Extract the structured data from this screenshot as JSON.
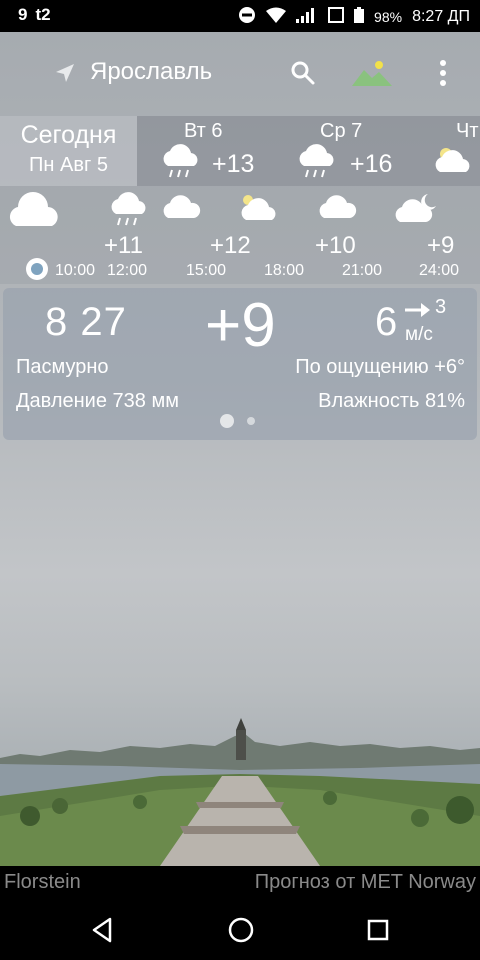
{
  "status_bar": {
    "notif_1": "9",
    "carrier": "t2",
    "battery": "98%",
    "time": "8:27 ДП"
  },
  "toolbar": {
    "city": "Ярославль"
  },
  "days": {
    "today": {
      "name": "Сегодня",
      "date": "Пн Авг 5"
    },
    "others": [
      {
        "name": "Вт 6",
        "temp": "+13",
        "icon": "cloud-rain-icon"
      },
      {
        "name": "Ср 7",
        "temp": "+16",
        "icon": "cloud-rain-icon"
      },
      {
        "name": "Чт",
        "temp": "",
        "icon": "sun-cloud-icon"
      }
    ]
  },
  "hourly": {
    "now_time": "10:00",
    "items": [
      {
        "time": "12:00",
        "temp": "+11",
        "icon": "cloud-rain-icon"
      },
      {
        "time": "15:00",
        "temp": "+12",
        "icon": "cloud-icon"
      },
      {
        "time": "18:00",
        "temp": "",
        "icon": "sun-cloud-icon"
      },
      {
        "time": "21:00",
        "temp": "+10",
        "icon": "cloud-icon"
      },
      {
        "time": "24:00",
        "temp": "+9",
        "icon": "moon-cloud-icon"
      }
    ],
    "mid_temp": "+12"
  },
  "current": {
    "clock": "8 27",
    "temp": "+9",
    "wind_speed": "6",
    "wind_gust": "3",
    "wind_unit": "м/с",
    "description": "Пасмурно",
    "feels_like": "По ощущению +6°",
    "pressure": "Давление 738 мм",
    "humidity": "Влажность 81%",
    "page_index": 1,
    "page_count": 2
  },
  "footer": {
    "author": "Florstein",
    "source": "Прогноз от MET Norway"
  }
}
